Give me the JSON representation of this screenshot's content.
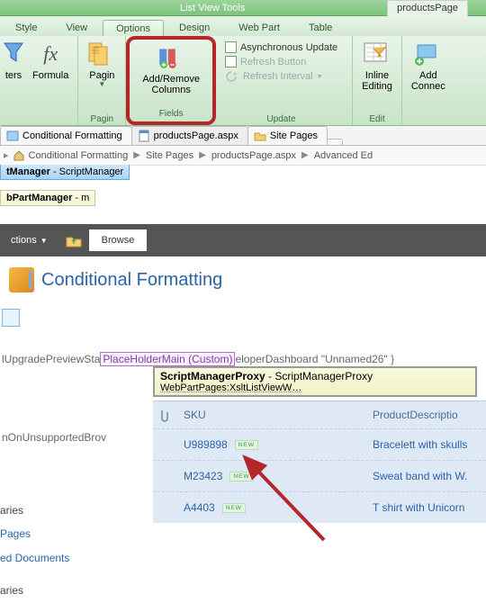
{
  "ribbon": {
    "context_title": "List View Tools",
    "context_rtab": "productsPage",
    "tabs": {
      "style": "Style",
      "view": "View",
      "options": "Options",
      "design": "Design",
      "webpart": "Web Part",
      "table": "Table"
    },
    "group_labels": {
      "paging": "Pagin",
      "fields": "Fields",
      "update": "Update",
      "edit": "Edit"
    },
    "buttons": {
      "filters": "ters",
      "formula": "Formula",
      "paging": "Pagin",
      "addremove": "Add/Remove\nColumns",
      "inline": "Inline\nEditing",
      "add_connect": "Add\nConnec"
    },
    "update_items": {
      "async": "Asynchronous Update",
      "refresh_btn": "Refresh Button",
      "refresh_int": "Refresh Interval"
    }
  },
  "doc_tabs": {
    "t1": "Conditional Formatting",
    "t2": "productsPage.aspx",
    "t3": "Site Pages"
  },
  "breadcrumb": {
    "b1": "Conditional Formatting",
    "b2": "Site Pages",
    "b3": "productsPage.aspx",
    "b4": "Advanced Ed"
  },
  "controls": {
    "c1_b": "tManager",
    "c1_t": " - ScriptManager",
    "c2_b": "bPartManager",
    "c2_t": " - m"
  },
  "graybar": {
    "actions": "ctions",
    "browse": "Browse"
  },
  "page_title": "Conditional Formatting",
  "code_line": {
    "pre": "lUpgradePreviewSta",
    "ph": "PlaceHolderMain (Custom)",
    "post": "eloperDashboard \"Unnamed26\" }",
    "line2": "nOnUnsupportedBrov"
  },
  "proxy": {
    "ln1b": "ScriptManagerProxy",
    "ln1r": " - ScriptManagerProxy",
    "ln2": "WebPartPages:XsltListViewW…"
  },
  "listview": {
    "head": {
      "sku": "SKU",
      "desc": "ProductDescriptio"
    },
    "rows": [
      {
        "sku": "U989898",
        "desc": "Bracelett with skulls"
      },
      {
        "sku": "M23423",
        "desc": "Sweat band with W."
      },
      {
        "sku": "A4403",
        "desc": "T shirt with Unicorn"
      }
    ],
    "new": "NEW"
  },
  "leftnav": {
    "h": "aries",
    "p": "Pages",
    "d": "ed Documents",
    "a": "aries"
  }
}
